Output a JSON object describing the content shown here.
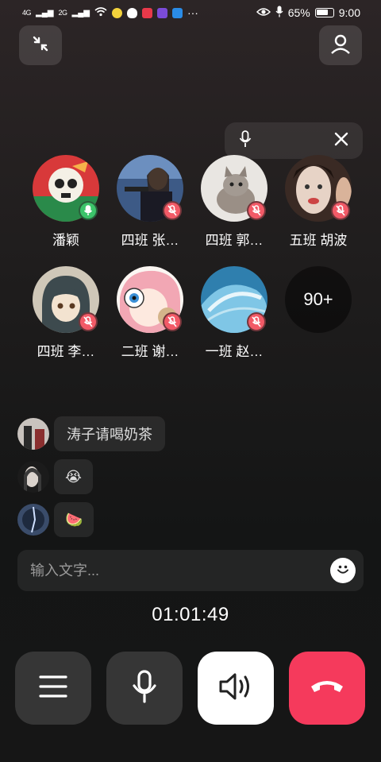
{
  "status_bar": {
    "signal1": "4G",
    "signal2": "2G",
    "battery_percent": "65%",
    "battery_level": 0.65,
    "time": "9:00",
    "more": "···"
  },
  "top_bar": {
    "collapse_icon": "collapse-arrows-icon",
    "profile_icon": "person-icon"
  },
  "mic_pill": {
    "mic_icon": "microphone-icon",
    "close_icon": "close-icon"
  },
  "participants": [
    {
      "name": "潘颖",
      "muted": false
    },
    {
      "name": "四班 张…",
      "muted": true
    },
    {
      "name": "四班 郭…",
      "muted": true
    },
    {
      "name": "五班 胡波",
      "muted": true
    },
    {
      "name": "四班 李…",
      "muted": true
    },
    {
      "name": "二班 谢…",
      "muted": true
    },
    {
      "name": "一班 赵…",
      "muted": true
    }
  ],
  "more_participants": "90+",
  "chat": {
    "messages": [
      {
        "text": "涛子请喝奶茶"
      },
      {
        "text": "😭"
      },
      {
        "text": "🍉"
      }
    ]
  },
  "input": {
    "placeholder": "输入文字..."
  },
  "timer": "01:01:49",
  "controls": {
    "menu_icon": "menu-icon",
    "mic_icon": "microphone-icon",
    "speaker_icon": "speaker-icon",
    "hangup_icon": "hang-up-icon",
    "hangup_color": "#f53a5c"
  }
}
